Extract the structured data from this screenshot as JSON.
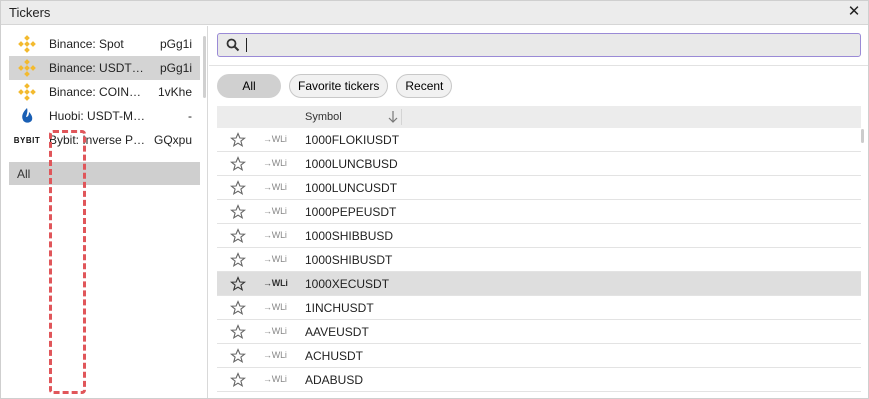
{
  "window": {
    "title": "Tickers",
    "close_glyph": "✕"
  },
  "exchanges": [
    {
      "name": "Binance: Spot",
      "code": "pGg1i",
      "icon": "binance-icon",
      "selected": false
    },
    {
      "name": "Binance: USDT…",
      "code": "pGg1i",
      "icon": "binance-icon",
      "selected": true
    },
    {
      "name": "Binance: COIN…",
      "code": "1vKhe",
      "icon": "binance-icon",
      "selected": false
    },
    {
      "name": "Huobi: USDT-M…",
      "code": "-",
      "icon": "huobi-icon",
      "selected": false
    },
    {
      "name": "Bybit: Inverse P…",
      "code": "GQxpu",
      "icon": "bybit-icon",
      "selected": false
    }
  ],
  "bybit_logo_text": "BYBIT",
  "all_label": "All",
  "search": {
    "value": "",
    "placeholder": ""
  },
  "filters": [
    {
      "label": "All",
      "active": true
    },
    {
      "label": "Favorite tickers",
      "active": false
    },
    {
      "label": "Recent",
      "active": false
    }
  ],
  "table": {
    "column_symbol": "Symbol",
    "wl_label": "→WLi",
    "rows": [
      {
        "symbol": "1000FLOKIUSDT",
        "hovered": false
      },
      {
        "symbol": "1000LUNCBUSD",
        "hovered": false
      },
      {
        "symbol": "1000LUNCUSDT",
        "hovered": false
      },
      {
        "symbol": "1000PEPEUSDT",
        "hovered": false
      },
      {
        "symbol": "1000SHIBBUSD",
        "hovered": false
      },
      {
        "symbol": "1000SHIBUSDT",
        "hovered": false
      },
      {
        "symbol": "1000XECUSDT",
        "hovered": true
      },
      {
        "symbol": "1INCHUSDT",
        "hovered": false
      },
      {
        "symbol": "AAVEUSDT",
        "hovered": false
      },
      {
        "symbol": "ACHUSDT",
        "hovered": false
      },
      {
        "symbol": "ADABUSD",
        "hovered": false
      }
    ]
  },
  "colors": {
    "binance": "#F3BA2F",
    "huobi": "#1A5FB4",
    "highlight_dash": "#E0565A",
    "search_border": "#9A8AD6"
  }
}
